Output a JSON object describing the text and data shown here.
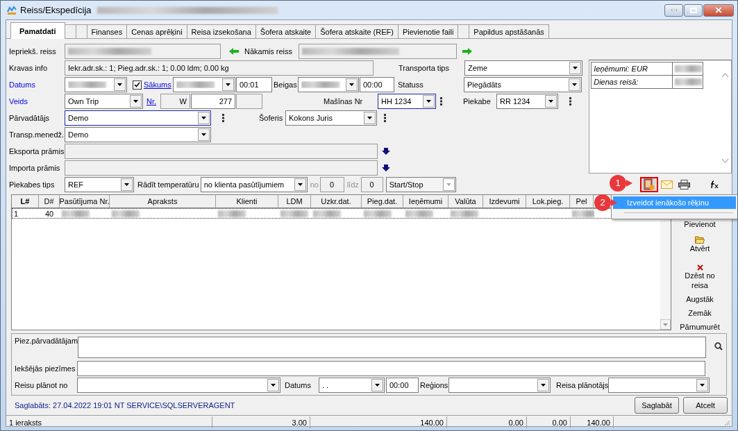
{
  "window": {
    "title": "Reiss/Ekspedīcija"
  },
  "tabs": [
    {
      "label": "Pamatdati",
      "selected": true
    },
    {
      "selected": false
    },
    {
      "selected": false
    },
    {
      "label": "Finanses",
      "selected": false
    },
    {
      "label": "Cenas aprēķini",
      "selected": false
    },
    {
      "label": "Reisa izsekošana",
      "selected": false
    },
    {
      "label": "Šofera atskaite",
      "selected": false
    },
    {
      "label": "Šofera atskaite (REF)",
      "selected": false
    },
    {
      "label": "Pievienotie faili",
      "selected": false
    },
    {
      "selected": false
    },
    {
      "label": "Papildus apstāšanās",
      "selected": false
    }
  ],
  "form": {
    "previous_trip": {
      "label": "Iepriekš. reiss"
    },
    "next_trip": {
      "label": "Nākamis reiss"
    },
    "cargo_info": {
      "label": "Kravas info",
      "value": "Iekr.adr.sk.: 1; Pieg.adr.sk.: 1; 0.00 ldm; 0.00 kg"
    },
    "transport_type": {
      "label": "Transporta tips",
      "value": "Zeme"
    },
    "date": {
      "label": "Datums"
    },
    "start": {
      "label": "Sākums",
      "checked": true,
      "time": "00:01"
    },
    "end": {
      "label": "Beigas",
      "time": "00:00"
    },
    "status": {
      "label": "Statuss",
      "value": "Piegādāts"
    },
    "type": {
      "label": "Veids",
      "value": "Own Trip"
    },
    "number": {
      "label": "Nr.",
      "prefix": "W",
      "value": "277"
    },
    "truck": {
      "label": "Mašīnas Nr",
      "value": "HH 1234"
    },
    "trailer": {
      "label": "Piekabe",
      "value": "RR 1234"
    },
    "carrier": {
      "label": "Pārvadātājs",
      "value": "Demo"
    },
    "driver": {
      "label": "Šoferis",
      "value": "Kokons Juris"
    },
    "manager": {
      "label": "Transp.menedž.",
      "value": "Demo"
    },
    "export_ferry": {
      "label": "Eksporta prāmis"
    },
    "import_ferry": {
      "label": "Importa prāmis"
    },
    "trailer_type": {
      "label": "Piekabes tips",
      "value": "REF"
    },
    "show_temperature": {
      "label": "Rādīt temperatūru",
      "value": "no klienta pasūtījumiem"
    },
    "temp_from": {
      "label": "no",
      "value": "0"
    },
    "temp_to": {
      "label": "līdz",
      "value": "0"
    },
    "mode": {
      "value": "Start/Stop",
      "disabled": true
    }
  },
  "summary": [
    {
      "label": "Ieņēmumi: EUR"
    },
    {
      "label": "Dienas reisā:"
    }
  ],
  "table": {
    "columns": [
      "L#",
      "D#",
      "Pasūtījuma Nr.",
      "Apraksts",
      "Klienti",
      "LDM",
      "Uzkr.dat.",
      "Pieg.dat.",
      "Ieņēmumi",
      "Valūta",
      "Izdevumi",
      "Lok.pieg.",
      "Pel"
    ],
    "rows": [
      {
        "cells": [
          {
            "kind": "text",
            "text": "1"
          },
          {
            "kind": "text",
            "text": "40"
          },
          {
            "kind": "blurred"
          },
          {
            "kind": "blurred"
          },
          {
            "kind": "blurred"
          },
          {
            "kind": "blurred"
          },
          {
            "kind": "blurred"
          },
          {
            "kind": "blurred"
          },
          {
            "kind": "blurred"
          },
          {
            "kind": "blurred"
          },
          {
            "kind": "empty"
          },
          {
            "kind": "empty"
          },
          {
            "kind": "blurred"
          }
        ]
      }
    ]
  },
  "side_buttons": [
    {
      "label": "Pievienot",
      "kind": "plain"
    },
    {
      "label": "Atvērt",
      "kind": "open"
    },
    {
      "label": "Dzēst no reisa",
      "kind": "delete"
    },
    {
      "label": "Augstāk",
      "kind": "plain"
    },
    {
      "label": "Zemāk",
      "kind": "plain"
    },
    {
      "label": "Pārnumurēt",
      "kind": "plain"
    }
  ],
  "context_menu": {
    "items": [
      {
        "label": "Izveidot ienākošo rēķinu",
        "selected": true
      }
    ]
  },
  "callouts": [
    {
      "label": "1"
    },
    {
      "label": "2"
    }
  ],
  "notes": {
    "carrier": {
      "label": "Piez.pārvadātājam"
    },
    "internal": {
      "label": "Iekšējās piezīmes"
    }
  },
  "planning": {
    "plan_from": {
      "label": "Reisu plānot no"
    },
    "date": {
      "label": "Datums",
      "value": ". .",
      "time": "00:00"
    },
    "region": {
      "label": "Reģions"
    },
    "planner": {
      "label": "Reisa plānotājs"
    }
  },
  "saved_info": "Saglabāts: 27.04.2022 19:01 NT SERVICE\\SQLSERVERAGENT",
  "buttons": [
    "Saglabāt",
    "Atcelt"
  ],
  "status_bar": [
    "1 ieraksts",
    "3.00",
    "140.00",
    "0.00",
    "0.00",
    "140.00"
  ]
}
